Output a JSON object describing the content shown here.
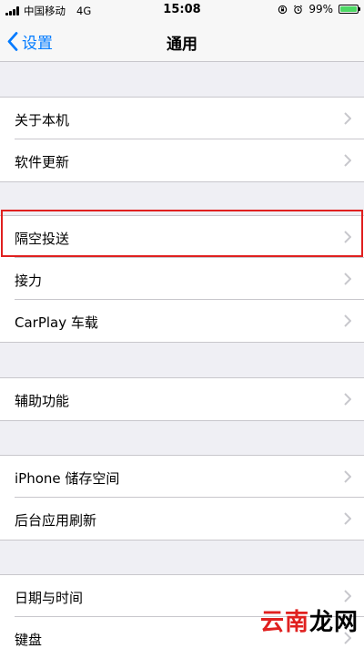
{
  "status_bar": {
    "carrier": "中国移动",
    "network": "4G",
    "time": "15:08",
    "battery_percent": "99%",
    "battery_level": 0.99,
    "battery_color": "#4cd964"
  },
  "nav": {
    "back_label": "设置",
    "title": "通用"
  },
  "groups": [
    {
      "items": [
        {
          "label": "关于本机"
        },
        {
          "label": "软件更新"
        }
      ]
    },
    {
      "items": [
        {
          "label": "隔空投送"
        },
        {
          "label": "接力"
        },
        {
          "label": "CarPlay 车载"
        }
      ]
    },
    {
      "items": [
        {
          "label": "辅助功能"
        }
      ]
    },
    {
      "items": [
        {
          "label": "iPhone 储存空间"
        },
        {
          "label": "后台应用刷新"
        }
      ]
    },
    {
      "items": [
        {
          "label": "日期与时间"
        },
        {
          "label": "键盘"
        }
      ]
    }
  ],
  "highlight_color": "#e0201f",
  "accent_color": "#007aff",
  "watermark": {
    "part1": "云南",
    "part2": "龙网",
    "color1": "#e0201f",
    "color2": "#000000"
  }
}
